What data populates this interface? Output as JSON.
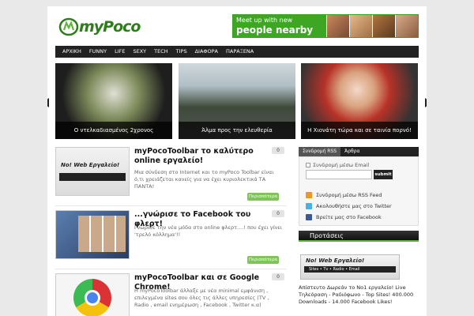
{
  "header": {
    "logo_text": "myPoco",
    "ad": {
      "line1": "Meet up with new",
      "line2": "people nearby"
    }
  },
  "nav": {
    "items": [
      "ΑΡΧΙΚΗ",
      "FUNNY",
      "LIFE",
      "SEXY",
      "TECH",
      "TIPS",
      "ΔΙΑΦΟΡΑ",
      "ΠΑΡΑΞΕΝΑ"
    ]
  },
  "slider": {
    "slides": [
      {
        "caption": "Ο ντελκαδιασμένος 2χρονος"
      },
      {
        "caption": "Άλμα προς την ελευθερία"
      },
      {
        "caption": "Η Χιονάτη τώρα και σε ταινία πορνό!"
      }
    ]
  },
  "posts": [
    {
      "title": "myPocoToolbar το καλύτερο online εργαλείο!",
      "excerpt": "Μια σύνδεση στο Internet και το myPoco Toolbar είναι ό,τι χρειάζεται κανείς για να έχει κυριολεκτικά ΤΑ ΠΑΝΤΑ!",
      "count": "0",
      "more": "Περισσότερα",
      "thumb_text": "No! Web Εργαλείο!"
    },
    {
      "title": "...γνώρισε το Facebook του φλερτ!",
      "excerpt": "Γνώρισε την νέα μόδα στο online φλερτ....! που έχει γίνει 'τρελό κόλλημα'!!",
      "count": "0",
      "more": "Περισσότερα"
    },
    {
      "title": "myPocoToolbar και σε Google Chrome!",
      "excerpt": "Η myPocoToolbar άλλαξε με νέα minimal εμφάνιση , επιλεγμένα sites σου όλες τις άλλες υπηρεσίες (TV , Radio , email ενημέρωση , Facebook , Twitter κ.α)",
      "count": "0"
    }
  ],
  "sidebar": {
    "tabs": [
      "Συνδρομή RSS",
      "Άρθρα"
    ],
    "email_label": "Συνδρομή μέσω Email",
    "email_value": "",
    "submit_label": "submit",
    "rows": [
      {
        "label": "Συνδρομή μέσω RSS Feed",
        "icon": "rss-icon"
      },
      {
        "label": "Ακολουθήστε μας στο Twitter",
        "icon": "twitter-icon"
      },
      {
        "label": "Βρείτε μας στο Facebook",
        "icon": "facebook-icon"
      }
    ],
    "section_title": "Προτάσεις",
    "promo": {
      "title": "No! Web Εργαλείο!",
      "strip": "Sites • Tv • Radio • Email",
      "text": "Απίστευτο Δωρεάν το No1 εργαλείο! Live Τηλεόραση - Ραδιόφωνο - Top Sites! 400.000 Downloads - 14.000 Facebook Likes!"
    }
  },
  "colors": {
    "accent_green": "#3da724",
    "nav_bg": "#222222"
  }
}
